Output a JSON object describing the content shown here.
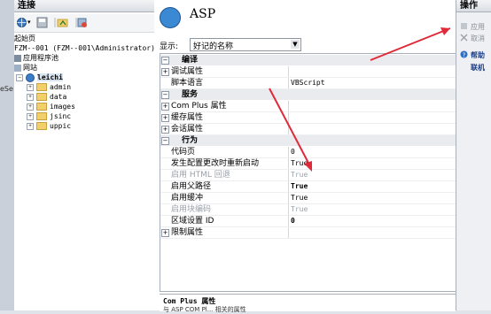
{
  "left_edge": {
    "label": "eSe"
  },
  "connections": {
    "title": "连接",
    "tree": [
      {
        "label": "起始页"
      },
      {
        "label": "FZM--001 (FZM--001\\Administrator)"
      },
      {
        "label": "应用程序池"
      },
      {
        "label": "网站"
      },
      {
        "label": "leichi"
      },
      {
        "label": "admin"
      },
      {
        "label": "data"
      },
      {
        "label": "images"
      },
      {
        "label": "jsinc"
      },
      {
        "label": "uppic"
      }
    ]
  },
  "main": {
    "title": "ASP",
    "display_label": "显示:",
    "display_value": "好记的名称",
    "grid": {
      "rows": [
        {
          "type": "cat",
          "name": "编译",
          "pm": "⊟"
        },
        {
          "type": "prop",
          "name": "调试属性",
          "value": "",
          "pm": "⊞"
        },
        {
          "type": "prop",
          "name": "脚本语言",
          "value": "VBScript",
          "pm": ""
        },
        {
          "type": "cat",
          "name": "服务",
          "pm": "⊟"
        },
        {
          "type": "prop",
          "name": "Com Plus 属性",
          "value": "",
          "pm": "⊞"
        },
        {
          "type": "prop",
          "name": "缓存属性",
          "value": "",
          "pm": "⊞"
        },
        {
          "type": "prop",
          "name": "会话属性",
          "value": "",
          "pm": "⊞"
        },
        {
          "type": "cat",
          "name": "行为",
          "pm": "⊟"
        },
        {
          "type": "prop",
          "name": "代码页",
          "value": "0",
          "pm": ""
        },
        {
          "type": "prop",
          "name": "发生配置更改时重新启动",
          "value": "True",
          "pm": ""
        },
        {
          "type": "prop",
          "name": "启用 HTML 回退",
          "value": "True",
          "pm": "",
          "dim": true
        },
        {
          "type": "prop",
          "name": "启用父路径",
          "value": "True",
          "pm": "",
          "bold": true
        },
        {
          "type": "prop",
          "name": "启用缓冲",
          "value": "True",
          "pm": ""
        },
        {
          "type": "prop",
          "name": "启用块编码",
          "value": "True",
          "pm": "",
          "dim": true
        },
        {
          "type": "prop",
          "name": "区域设置 ID",
          "value": "0",
          "pm": "",
          "bold": true
        },
        {
          "type": "prop",
          "name": "限制属性",
          "value": "",
          "pm": "⊞"
        }
      ]
    },
    "description": {
      "title": "Com Plus 属性",
      "text": "与 ASP COM Pl... 相关的属性"
    }
  },
  "actions": {
    "title": "操作",
    "items": [
      {
        "label": "应用",
        "icon": "apply-icon"
      },
      {
        "label": "取消",
        "icon": "cancel-icon"
      },
      {
        "label": "帮助",
        "icon": "help-icon"
      },
      {
        "label": "联机",
        "icon": "online-help-icon"
      }
    ]
  },
  "colors": {
    "arrow": "#e02a3a",
    "accent": "#3b88d3"
  }
}
